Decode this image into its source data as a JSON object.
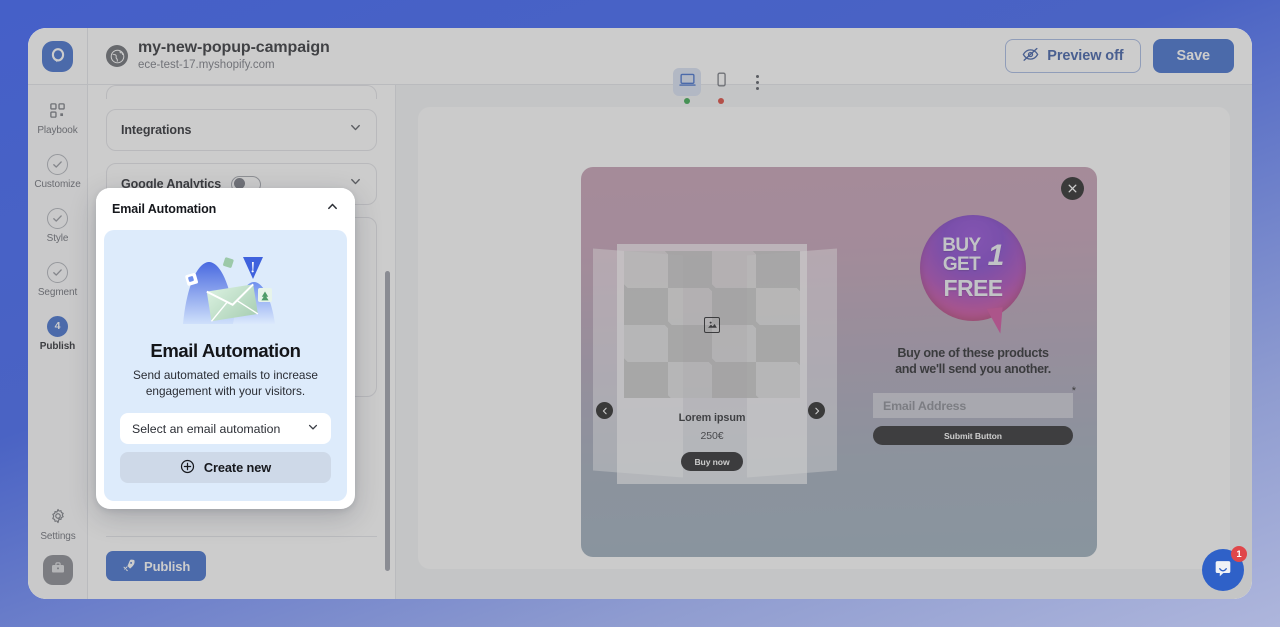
{
  "header": {
    "logo_icon": "app-logo-icon",
    "site_icon": "globe-icon",
    "campaign_name": "my-new-popup-campaign",
    "store_domain": "ece-test-17.myshopify.com",
    "devices": [
      {
        "icon": "desktop-icon",
        "name": "desktop",
        "active": true,
        "status_color": "#27a03f"
      },
      {
        "icon": "mobile-icon",
        "name": "mobile",
        "active": false,
        "status_color": "#d8372c"
      }
    ],
    "more_menu_icon": "kebab-menu-icon",
    "preview_label": "Preview off",
    "preview_icon": "eye-off-icon",
    "save_label": "Save"
  },
  "rail": {
    "items": [
      {
        "label": "Playbook",
        "icon": "grid-icon",
        "state": "plain"
      },
      {
        "label": "Customize",
        "icon": "check-circle-icon",
        "state": "done"
      },
      {
        "label": "Style",
        "icon": "check-circle-icon",
        "state": "done"
      },
      {
        "label": "Segment",
        "icon": "check-circle-icon",
        "state": "done"
      },
      {
        "label": "Publish",
        "icon": "step-number",
        "state": "current",
        "step": "4"
      }
    ],
    "settings_label": "Settings",
    "settings_icon": "gear-icon",
    "avatar_icon": "briefcase-icon"
  },
  "panel": {
    "sections": [
      {
        "title": "Integrations",
        "caret": "chevron-down-icon",
        "has_toggle": false
      },
      {
        "title": "Google Analytics",
        "caret": "chevron-down-icon",
        "has_toggle": true,
        "toggle_on": false
      }
    ],
    "publish_label": "Publish",
    "publish_icon": "rocket-icon"
  },
  "email_automation": {
    "header_title": "Email Automation",
    "collapse_icon": "chevron-up-icon",
    "illustration": "email-hills-illustration",
    "title": "Email Automation",
    "description": "Send automated emails to increase engagement with your visitors.",
    "select_placeholder": "Select an email automation",
    "select_caret": "chevron-down-icon",
    "create_label": "Create new",
    "create_icon": "plus-circle-icon"
  },
  "popup_preview": {
    "close_icon": "close-icon",
    "prev_icon": "chevron-left-icon",
    "next_icon": "chevron-right-icon",
    "product": {
      "image_placeholder_icon": "image-placeholder-icon",
      "title": "Lorem ipsum",
      "price": "250€",
      "buy_label": "Buy now"
    },
    "badge": {
      "line1": "BUY",
      "line2": "GET",
      "number": "1",
      "line3": "FREE"
    },
    "headline_line1": "Buy one of these products",
    "headline_line2": "and we'll send you another.",
    "email_placeholder": "Email Address",
    "required_marker": "*",
    "submit_label": "Submit Button"
  },
  "chat": {
    "icon": "chat-bubble-icon",
    "unread_count": "1"
  },
  "colors": {
    "brand_blue": "#2f61c8",
    "desktop_status": "#27a03f",
    "mobile_status": "#d8372c",
    "badge_red": "#e0474a"
  }
}
